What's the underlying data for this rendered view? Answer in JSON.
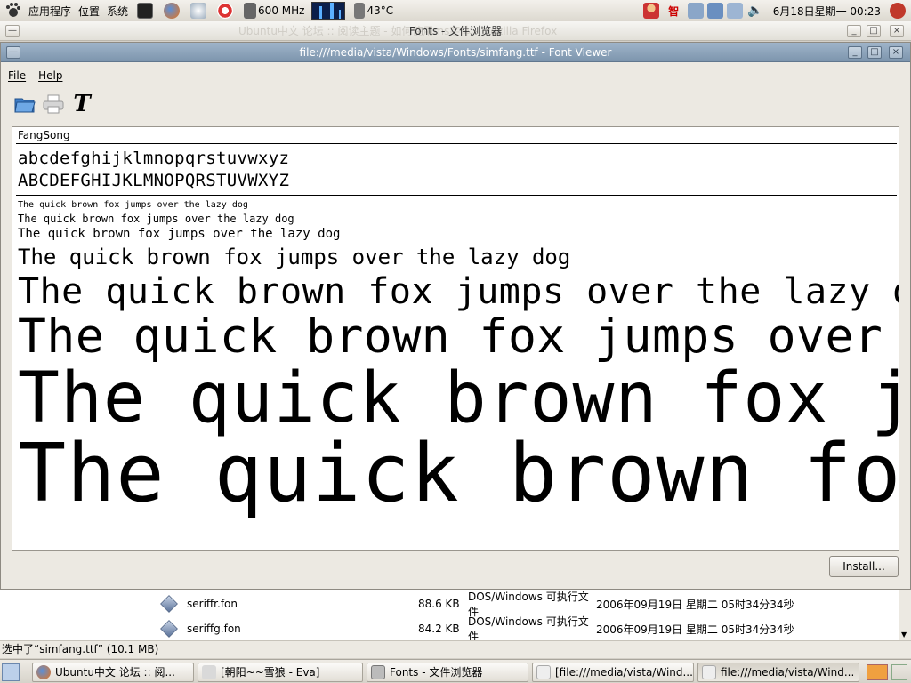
{
  "top_panel": {
    "applications": "应用程序",
    "places": "位置",
    "system": "系统",
    "cpu_freq": "600 MHz",
    "temperature": "43°C",
    "ime": "智",
    "datetime": "6月18日星期一 00:23"
  },
  "bg_window": {
    "title": "Fonts - 文件浏览器",
    "ghost_title": "Ubuntu中文 论坛 :: 阅读主题 - 如何使用ms字体 - Mozilla Firefox"
  },
  "font_viewer": {
    "title": "file:///media/vista/Windows/Fonts/simfang.ttf - Font Viewer",
    "menus": [
      "File",
      "Help"
    ],
    "font_name": "FangSong",
    "lowercase": "abcdefghijklmnopqrstuvwxyz",
    "uppercase": "ABCDEFGHIJKLMNOPQRSTUVWXYZ",
    "pangram": "The quick brown fox jumps over the lazy dog",
    "install_label": "Install..."
  },
  "file_list": [
    {
      "name": "seriffr.fon",
      "size": "88.6 KB",
      "type": "DOS/Windows 可执行文件",
      "date": "2006年09月19日 星期二 05时34分34秒"
    },
    {
      "name": "seriffg.fon",
      "size": "84.2 KB",
      "type": "DOS/Windows 可执行文件",
      "date": "2006年09月19日 星期二 05时34分34秒"
    }
  ],
  "status_text": "选中了“simfang.ttf” (10.1 MB)",
  "taskbar": [
    {
      "label": "Ubuntu中文 论坛 :: 阅..."
    },
    {
      "label": "[朝阳~~雪狼 - Eva]"
    },
    {
      "label": "Fonts - 文件浏览器"
    },
    {
      "label": "[file:///media/vista/Wind..."
    },
    {
      "label": "file:///media/vista/Wind..."
    }
  ]
}
